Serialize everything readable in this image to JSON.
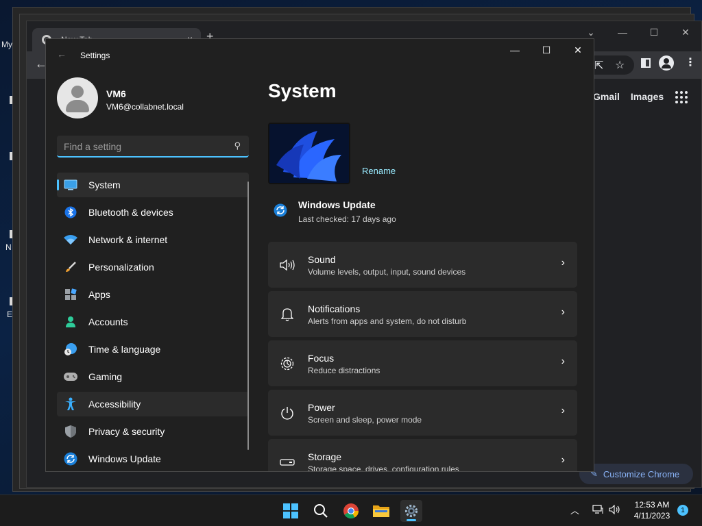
{
  "desktop": {
    "labels": [
      "My",
      "N",
      "E"
    ]
  },
  "chrome": {
    "tab_title": "New Tab",
    "tab_close": "×",
    "new_tab": "+",
    "links": [
      "Gmail",
      "Images"
    ],
    "customize_label": "Customize Chrome"
  },
  "settings": {
    "app_title": "Settings",
    "user": {
      "name": "VM6",
      "email": "VM6@collabnet.local"
    },
    "search": {
      "placeholder": "Find a setting"
    },
    "nav": [
      {
        "label": "System",
        "icon": "system-icon",
        "state": "active"
      },
      {
        "label": "Bluetooth & devices",
        "icon": "bluetooth-icon"
      },
      {
        "label": "Network & internet",
        "icon": "wifi-icon"
      },
      {
        "label": "Personalization",
        "icon": "brush-icon"
      },
      {
        "label": "Apps",
        "icon": "apps-icon"
      },
      {
        "label": "Accounts",
        "icon": "accounts-icon"
      },
      {
        "label": "Time & language",
        "icon": "clock-globe-icon"
      },
      {
        "label": "Gaming",
        "icon": "gamepad-icon"
      },
      {
        "label": "Accessibility",
        "icon": "accessibility-icon",
        "state": "hover"
      },
      {
        "label": "Privacy & security",
        "icon": "shield-icon"
      },
      {
        "label": "Windows Update",
        "icon": "update-icon"
      }
    ],
    "page_title": "System",
    "rename_label": "Rename",
    "windows_update": {
      "title": "Windows Update",
      "subtitle": "Last checked: 17 days ago"
    },
    "cards": [
      {
        "title": "Sound",
        "subtitle": "Volume levels, output, input, sound devices",
        "icon": "speaker-icon"
      },
      {
        "title": "Notifications",
        "subtitle": "Alerts from apps and system, do not disturb",
        "icon": "bell-icon"
      },
      {
        "title": "Focus",
        "subtitle": "Reduce distractions",
        "icon": "focus-icon"
      },
      {
        "title": "Power",
        "subtitle": "Screen and sleep, power mode",
        "icon": "power-icon"
      },
      {
        "title": "Storage",
        "subtitle": "Storage space, drives, configuration rules",
        "icon": "storage-icon"
      }
    ]
  },
  "taskbar": {
    "time": "12:53 AM",
    "date": "4/11/2023",
    "notification_count": "1"
  },
  "colors": {
    "accent": "#4cc2ff",
    "link": "#99ebff",
    "window_bg": "#202020",
    "card_bg": "#2b2b2b"
  }
}
